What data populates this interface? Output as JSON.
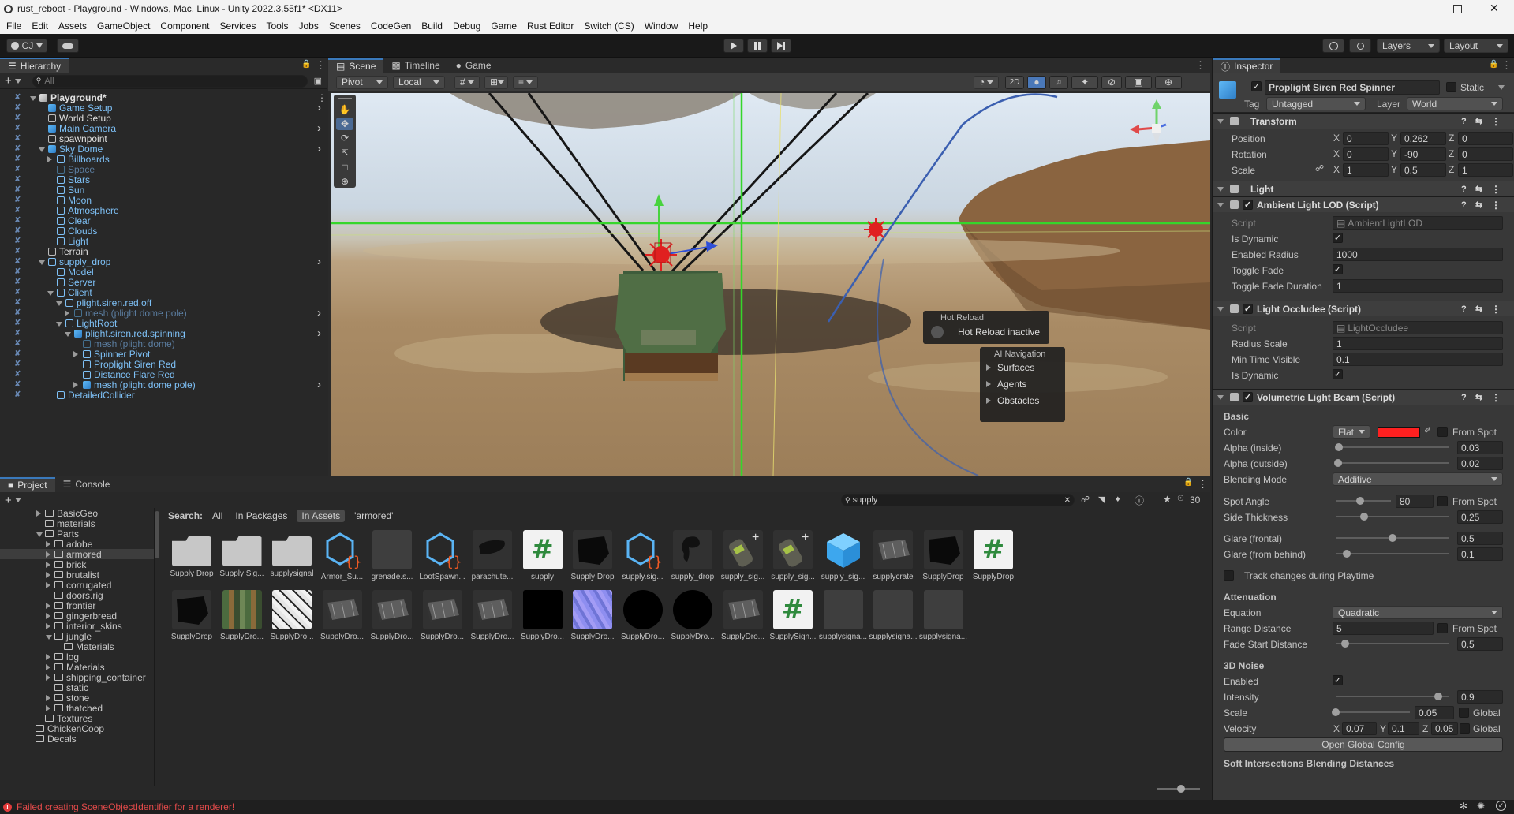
{
  "window": {
    "title": "rust_reboot - Playground - Windows, Mac, Linux - Unity 2022.3.55f1* <DX11>"
  },
  "menu": [
    "File",
    "Edit",
    "Assets",
    "GameObject",
    "Component",
    "Services",
    "Tools",
    "Jobs",
    "Scenes",
    "CodeGen",
    "Build",
    "Debug",
    "Game",
    "Rust Editor",
    "Switch (CS)",
    "Window",
    "Help"
  ],
  "toolbar": {
    "account": "CJ",
    "layers": "Layers",
    "layout": "Layout"
  },
  "hierarchy": {
    "title": "Hierarchy",
    "search_placeholder": "All",
    "items": [
      {
        "label": "Playground*",
        "depth": 0,
        "kind": "scene",
        "bold": true,
        "arrow": "down"
      },
      {
        "label": "Game Setup",
        "depth": 1,
        "kind": "prefab",
        "more": true
      },
      {
        "label": "World Setup",
        "depth": 1,
        "kind": "obj"
      },
      {
        "label": "Main Camera",
        "depth": 1,
        "kind": "prefab",
        "more": true
      },
      {
        "label": "spawnpoint",
        "depth": 1,
        "kind": "obj"
      },
      {
        "label": "Sky Dome",
        "depth": 1,
        "kind": "prefab",
        "arrow": "down",
        "more": true
      },
      {
        "label": "Billboards",
        "depth": 2,
        "kind": "prefabf",
        "arrow": "right"
      },
      {
        "label": "Space",
        "depth": 2,
        "kind": "disabled"
      },
      {
        "label": "Stars",
        "depth": 2,
        "kind": "prefabf"
      },
      {
        "label": "Sun",
        "depth": 2,
        "kind": "prefabf"
      },
      {
        "label": "Moon",
        "depth": 2,
        "kind": "prefabf"
      },
      {
        "label": "Atmosphere",
        "depth": 2,
        "kind": "prefabf"
      },
      {
        "label": "Clear",
        "depth": 2,
        "kind": "prefabf"
      },
      {
        "label": "Clouds",
        "depth": 2,
        "kind": "prefabf"
      },
      {
        "label": "Light",
        "depth": 2,
        "kind": "prefabf"
      },
      {
        "label": "Terrain",
        "depth": 1,
        "kind": "obj"
      },
      {
        "label": "supply_drop",
        "depth": 1,
        "kind": "prefabf",
        "arrow": "down",
        "more": true
      },
      {
        "label": "Model",
        "depth": 2,
        "kind": "prefabf"
      },
      {
        "label": "Server",
        "depth": 2,
        "kind": "prefabf"
      },
      {
        "label": "Client",
        "depth": 2,
        "kind": "prefabf",
        "arrow": "down"
      },
      {
        "label": "plight.siren.red.off",
        "depth": 3,
        "kind": "prefabf",
        "arrow": "down"
      },
      {
        "label": "mesh (plight dome pole)",
        "depth": 4,
        "kind": "disabled",
        "arrow": "right",
        "more": true
      },
      {
        "label": "LightRoot",
        "depth": 3,
        "kind": "prefabf",
        "arrow": "down"
      },
      {
        "label": "plight.siren.red.spinning",
        "depth": 4,
        "kind": "prefab",
        "arrow": "down",
        "more": true
      },
      {
        "label": "mesh (plight dome)",
        "depth": 5,
        "kind": "disabled"
      },
      {
        "label": "Spinner Pivot",
        "depth": 5,
        "kind": "prefabf",
        "arrow": "right"
      },
      {
        "label": "Proplight Siren Red",
        "depth": 5,
        "kind": "prefabf"
      },
      {
        "label": "Distance Flare Red",
        "depth": 5,
        "kind": "prefabf"
      },
      {
        "label": "mesh (plight dome pole)",
        "depth": 5,
        "kind": "prefab",
        "arrow": "right",
        "more": true
      },
      {
        "label": "DetailedCollider",
        "depth": 2,
        "kind": "prefabf"
      }
    ]
  },
  "scene_tabs": [
    "Scene",
    "Timeline",
    "Game"
  ],
  "scene_toolbar": {
    "pivot": "Pivot",
    "local": "Local",
    "mode2d": "2D"
  },
  "hot_reload": {
    "title": "Hot Reload",
    "status": "Hot Reload inactive"
  },
  "ai_nav": {
    "title": "AI Navigation",
    "items": [
      "Surfaces",
      "Agents",
      "Obstacles"
    ]
  },
  "project": {
    "tabs": [
      "Project",
      "Console"
    ],
    "search_value": "supply",
    "count": "30",
    "filter": {
      "label": "Search:",
      "all": "All",
      "packages": "In Packages",
      "assets": "In Assets",
      "folder": "'armored'"
    },
    "tree": [
      {
        "label": "BasicGeo",
        "depth": 2,
        "arrow": "right"
      },
      {
        "label": "materials",
        "depth": 2
      },
      {
        "label": "Parts",
        "depth": 2,
        "arrow": "down"
      },
      {
        "label": "adobe",
        "depth": 3,
        "arrow": "right"
      },
      {
        "label": "armored",
        "depth": 3,
        "arrow": "right",
        "selected": true
      },
      {
        "label": "brick",
        "depth": 3,
        "arrow": "right"
      },
      {
        "label": "brutalist",
        "depth": 3,
        "arrow": "right"
      },
      {
        "label": "corrugated",
        "depth": 3,
        "arrow": "right"
      },
      {
        "label": "doors.rig",
        "depth": 3
      },
      {
        "label": "frontier",
        "depth": 3,
        "arrow": "right"
      },
      {
        "label": "gingerbread",
        "depth": 3,
        "arrow": "right"
      },
      {
        "label": "interior_skins",
        "depth": 3,
        "arrow": "right"
      },
      {
        "label": "jungle",
        "depth": 3,
        "arrow": "down"
      },
      {
        "label": "Materials",
        "depth": 4
      },
      {
        "label": "log",
        "depth": 3,
        "arrow": "right"
      },
      {
        "label": "Materials",
        "depth": 3,
        "arrow": "right"
      },
      {
        "label": "shipping_container",
        "depth": 3,
        "arrow": "right"
      },
      {
        "label": "static",
        "depth": 3
      },
      {
        "label": "stone",
        "depth": 3,
        "arrow": "right"
      },
      {
        "label": "thatched",
        "depth": 3,
        "arrow": "right"
      },
      {
        "label": "Textures",
        "depth": 2
      },
      {
        "label": "ChickenCoop",
        "depth": 1
      },
      {
        "label": "Decals",
        "depth": 1
      }
    ],
    "assets_row1": [
      {
        "label": "Supply Drop",
        "kind": "folder"
      },
      {
        "label": "Supply Sig...",
        "kind": "folder"
      },
      {
        "label": "supplysignal",
        "kind": "folder"
      },
      {
        "label": "Armor_Su...",
        "kind": "prefabvar"
      },
      {
        "label": "grenade.s...",
        "kind": "gray"
      },
      {
        "label": "LootSpawn...",
        "kind": "prefabvar"
      },
      {
        "label": "parachute...",
        "kind": "mesh"
      },
      {
        "label": "supply",
        "kind": "script"
      },
      {
        "label": "Supply Drop",
        "kind": "meshblack"
      },
      {
        "label": "supply.sig...",
        "kind": "prefabvar"
      },
      {
        "label": "supply_drop",
        "kind": "shape"
      },
      {
        "label": "supply_sig...",
        "kind": "can"
      },
      {
        "label": "supply_sig...",
        "kind": "can"
      },
      {
        "label": "supply_sig...",
        "kind": "prefabcube"
      },
      {
        "label": "supplycrate",
        "kind": "crate"
      },
      {
        "label": "SupplyDrop",
        "kind": "meshblack"
      },
      {
        "label": "SupplyDrop",
        "kind": "script"
      }
    ],
    "assets_row2": [
      {
        "label": "SupplyDrop",
        "kind": "meshblack"
      },
      {
        "label": "SupplyDro...",
        "kind": "texcolor"
      },
      {
        "label": "SupplyDro...",
        "kind": "texwhite"
      },
      {
        "label": "SupplyDro...",
        "kind": "crate"
      },
      {
        "label": "SupplyDro...",
        "kind": "crate"
      },
      {
        "label": "SupplyDro...",
        "kind": "crate"
      },
      {
        "label": "SupplyDro...",
        "kind": "crate"
      },
      {
        "label": "SupplyDro...",
        "kind": "black"
      },
      {
        "label": "SupplyDro...",
        "kind": "normal"
      },
      {
        "label": "SupplyDro...",
        "kind": "circle"
      },
      {
        "label": "SupplyDro...",
        "kind": "circle"
      },
      {
        "label": "SupplyDro...",
        "kind": "crate"
      },
      {
        "label": "SupplySign...",
        "kind": "script"
      },
      {
        "label": "supplysigna...",
        "kind": "gray"
      },
      {
        "label": "supplysigna...",
        "kind": "gray"
      },
      {
        "label": "supplysigna...",
        "kind": "gray"
      }
    ]
  },
  "status": {
    "error": "Failed creating SceneObjectIdentifier for a renderer!"
  },
  "inspector": {
    "title": "Inspector",
    "object_name": "Proplight Siren Red Spinner",
    "static_label": "Static",
    "tag_label": "Tag",
    "tag": "Untagged",
    "layer_label": "Layer",
    "layer": "World",
    "transform": {
      "title": "Transform",
      "position": {
        "label": "Position",
        "x": "0",
        "y": "0.262",
        "z": "0"
      },
      "rotation": {
        "label": "Rotation",
        "x": "0",
        "y": "-90",
        "z": "0"
      },
      "scale": {
        "label": "Scale",
        "x": "1",
        "y": "0.5",
        "z": "1"
      }
    },
    "light": {
      "title": "Light"
    },
    "ambient": {
      "title": "Ambient Light LOD (Script)",
      "script_label": "Script",
      "script": "AmbientLightLOD",
      "is_dynamic": "Is Dynamic",
      "enabled_radius": "Enabled Radius",
      "enabled_radius_val": "1000",
      "toggle_fade": "Toggle Fade",
      "toggle_fade_duration": "Toggle Fade Duration",
      "toggle_fade_duration_val": "1"
    },
    "occludee": {
      "title": "Light Occludee (Script)",
      "script_label": "Script",
      "script": "LightOccludee",
      "radius_scale": "Radius Scale",
      "radius_scale_val": "1",
      "min_time": "Min Time Visible",
      "min_time_val": "0.1",
      "is_dynamic": "Is Dynamic"
    },
    "beam": {
      "title": "Volumetric Light Beam (Script)",
      "basic": "Basic",
      "color": "Color",
      "color_mode": "Flat",
      "from_spot": "From Spot",
      "alpha_in": "Alpha (inside)",
      "alpha_in_val": "0.03",
      "alpha_in_pct": 0.03,
      "alpha_out": "Alpha (outside)",
      "alpha_out_val": "0.02",
      "alpha_out_pct": 0.02,
      "blending": "Blending Mode",
      "blending_val": "Additive",
      "spot_angle": "Spot Angle",
      "spot_angle_val": "80",
      "spot_angle_pct": 0.44,
      "side": "Side Thickness",
      "side_val": "0.25",
      "side_pct": 0.25,
      "glare_f": "Glare (frontal)",
      "glare_f_val": "0.5",
      "glare_f_pct": 0.5,
      "glare_b": "Glare (from behind)",
      "glare_b_val": "0.1",
      "glare_b_pct": 0.1,
      "track": "Track changes during Playtime",
      "attenuation": "Attenuation",
      "equation": "Equation",
      "equation_val": "Quadratic",
      "range": "Range Distance",
      "range_val": "5",
      "fade_start": "Fade Start Distance",
      "fade_start_val": "0.5",
      "fade_start_pct": 0.08,
      "noise": "3D Noise",
      "enabled": "Enabled",
      "intensity": "Intensity",
      "intensity_val": "0.9",
      "intensity_pct": 0.9,
      "scale": "Scale",
      "scale_val": "0.05",
      "scale_pct": 0.0,
      "global": "Global",
      "velocity": "Velocity",
      "vx": "0.07",
      "vy": "0.1",
      "vz": "0.05",
      "open_global": "Open Global Config",
      "soft": "Soft Intersections Blending Distances"
    }
  }
}
